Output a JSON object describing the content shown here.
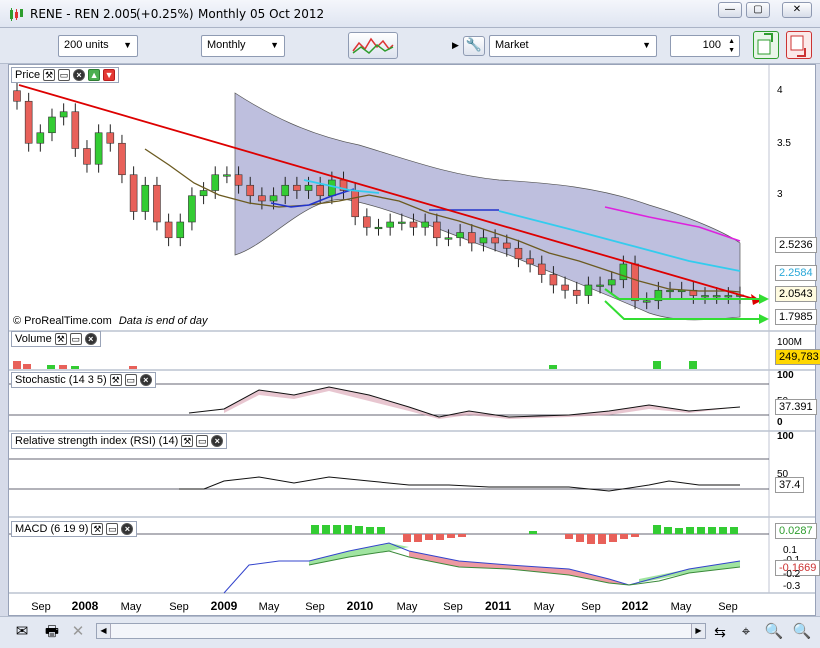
{
  "window": {
    "symbol": "RENE - REN",
    "price": "2.005",
    "change": "(+0.25%)",
    "period": "Monthly",
    "date": "05 Oct 2012",
    "buttons": {
      "minimize": "—",
      "restore": "▢",
      "close": "✕"
    }
  },
  "toolbar": {
    "units": "200 units",
    "interval": "Monthly",
    "order_type": "Market",
    "quantity": "100"
  },
  "price_panel": {
    "title": "Price",
    "watermark": "© ProRealTime.com",
    "note": "Data is end of day",
    "y_ticks": [
      "4",
      "3.5",
      "3"
    ],
    "badges": [
      "2.5236",
      "2.2584",
      "2.0543",
      "1.7985"
    ]
  },
  "volume_panel": {
    "title": "Volume",
    "max_label": "100M",
    "value": "249,783"
  },
  "stochastic_panel": {
    "title": "Stochastic (14 3 5)",
    "ticks": [
      "100",
      "50",
      "0"
    ],
    "value": "37.391"
  },
  "rsi_panel": {
    "title": "Relative strength index (RSI) (14)",
    "ticks": [
      "100",
      "50"
    ],
    "value": "37.4"
  },
  "macd_panel": {
    "title": "MACD (6 19 9)",
    "ticks": [
      "0.1",
      "-0.1",
      "-0.2",
      "-0.3"
    ],
    "values": [
      "0.0287",
      "-0.1669"
    ]
  },
  "x_axis": [
    "Sep",
    "2008",
    "May",
    "Sep",
    "2009",
    "May",
    "Sep",
    "2010",
    "May",
    "Sep",
    "2011",
    "May",
    "Sep",
    "2012",
    "May",
    "Sep"
  ],
  "colors": {
    "up": "#33cc33",
    "down": "#e8615a",
    "trend": "#dd0000",
    "band": "#a8a9d3"
  },
  "chart_data": {
    "type": "candlestick",
    "x": [
      "Aug 2007",
      "Sep 2007",
      "Oct 2007",
      "Nov 2007",
      "Dec 2007",
      "Jan 2008",
      "Feb 2008",
      "Mar 2008",
      "Apr 2008",
      "May 2008",
      "Jun 2008",
      "Jul 2008",
      "Aug 2008",
      "Sep 2008",
      "Oct 2008",
      "Nov 2008",
      "Dec 2008",
      "Jan 2009",
      "Feb 2009",
      "Mar 2009",
      "Apr 2009",
      "May 2009",
      "Jun 2009",
      "Jul 2009",
      "Aug 2009",
      "Sep 2009",
      "Oct 2009",
      "Nov 2009",
      "Dec 2009",
      "Jan 2010",
      "Feb 2010",
      "Mar 2010",
      "Apr 2010",
      "May 2010",
      "Jun 2010",
      "Jul 2010",
      "Aug 2010",
      "Sep 2010",
      "Oct 2010",
      "Nov 2010",
      "Dec 2010",
      "Jan 2011",
      "Feb 2011",
      "Mar 2011",
      "Apr 2011",
      "May 2011",
      "Jun 2011",
      "Jul 2011",
      "Aug 2011",
      "Sep 2011",
      "Oct 2011",
      "Nov 2011",
      "Dec 2011",
      "Jan 2012",
      "Feb 2012",
      "Mar 2012",
      "Apr 2012",
      "May 2012",
      "Jun 2012",
      "Jul 2012",
      "Aug 2012",
      "Sep 2012",
      "Oct 2012"
    ],
    "close": [
      3.85,
      3.45,
      3.55,
      3.7,
      3.75,
      3.4,
      3.25,
      3.55,
      3.45,
      3.15,
      2.8,
      3.05,
      2.7,
      2.55,
      2.7,
      2.95,
      3.0,
      3.15,
      3.15,
      3.05,
      2.95,
      2.9,
      2.95,
      3.05,
      3.0,
      3.05,
      2.95,
      3.1,
      3.0,
      2.75,
      2.65,
      2.65,
      2.7,
      2.7,
      2.65,
      2.7,
      2.55,
      2.55,
      2.6,
      2.5,
      2.55,
      2.5,
      2.45,
      2.35,
      2.3,
      2.2,
      2.1,
      2.05,
      2.0,
      2.1,
      2.1,
      2.15,
      2.3,
      1.95,
      1.95,
      2.05,
      2.05,
      2.05,
      2.0,
      2.0,
      2.0,
      2.0,
      2.005
    ],
    "y_range": [
      1.7,
      4.1
    ]
  }
}
